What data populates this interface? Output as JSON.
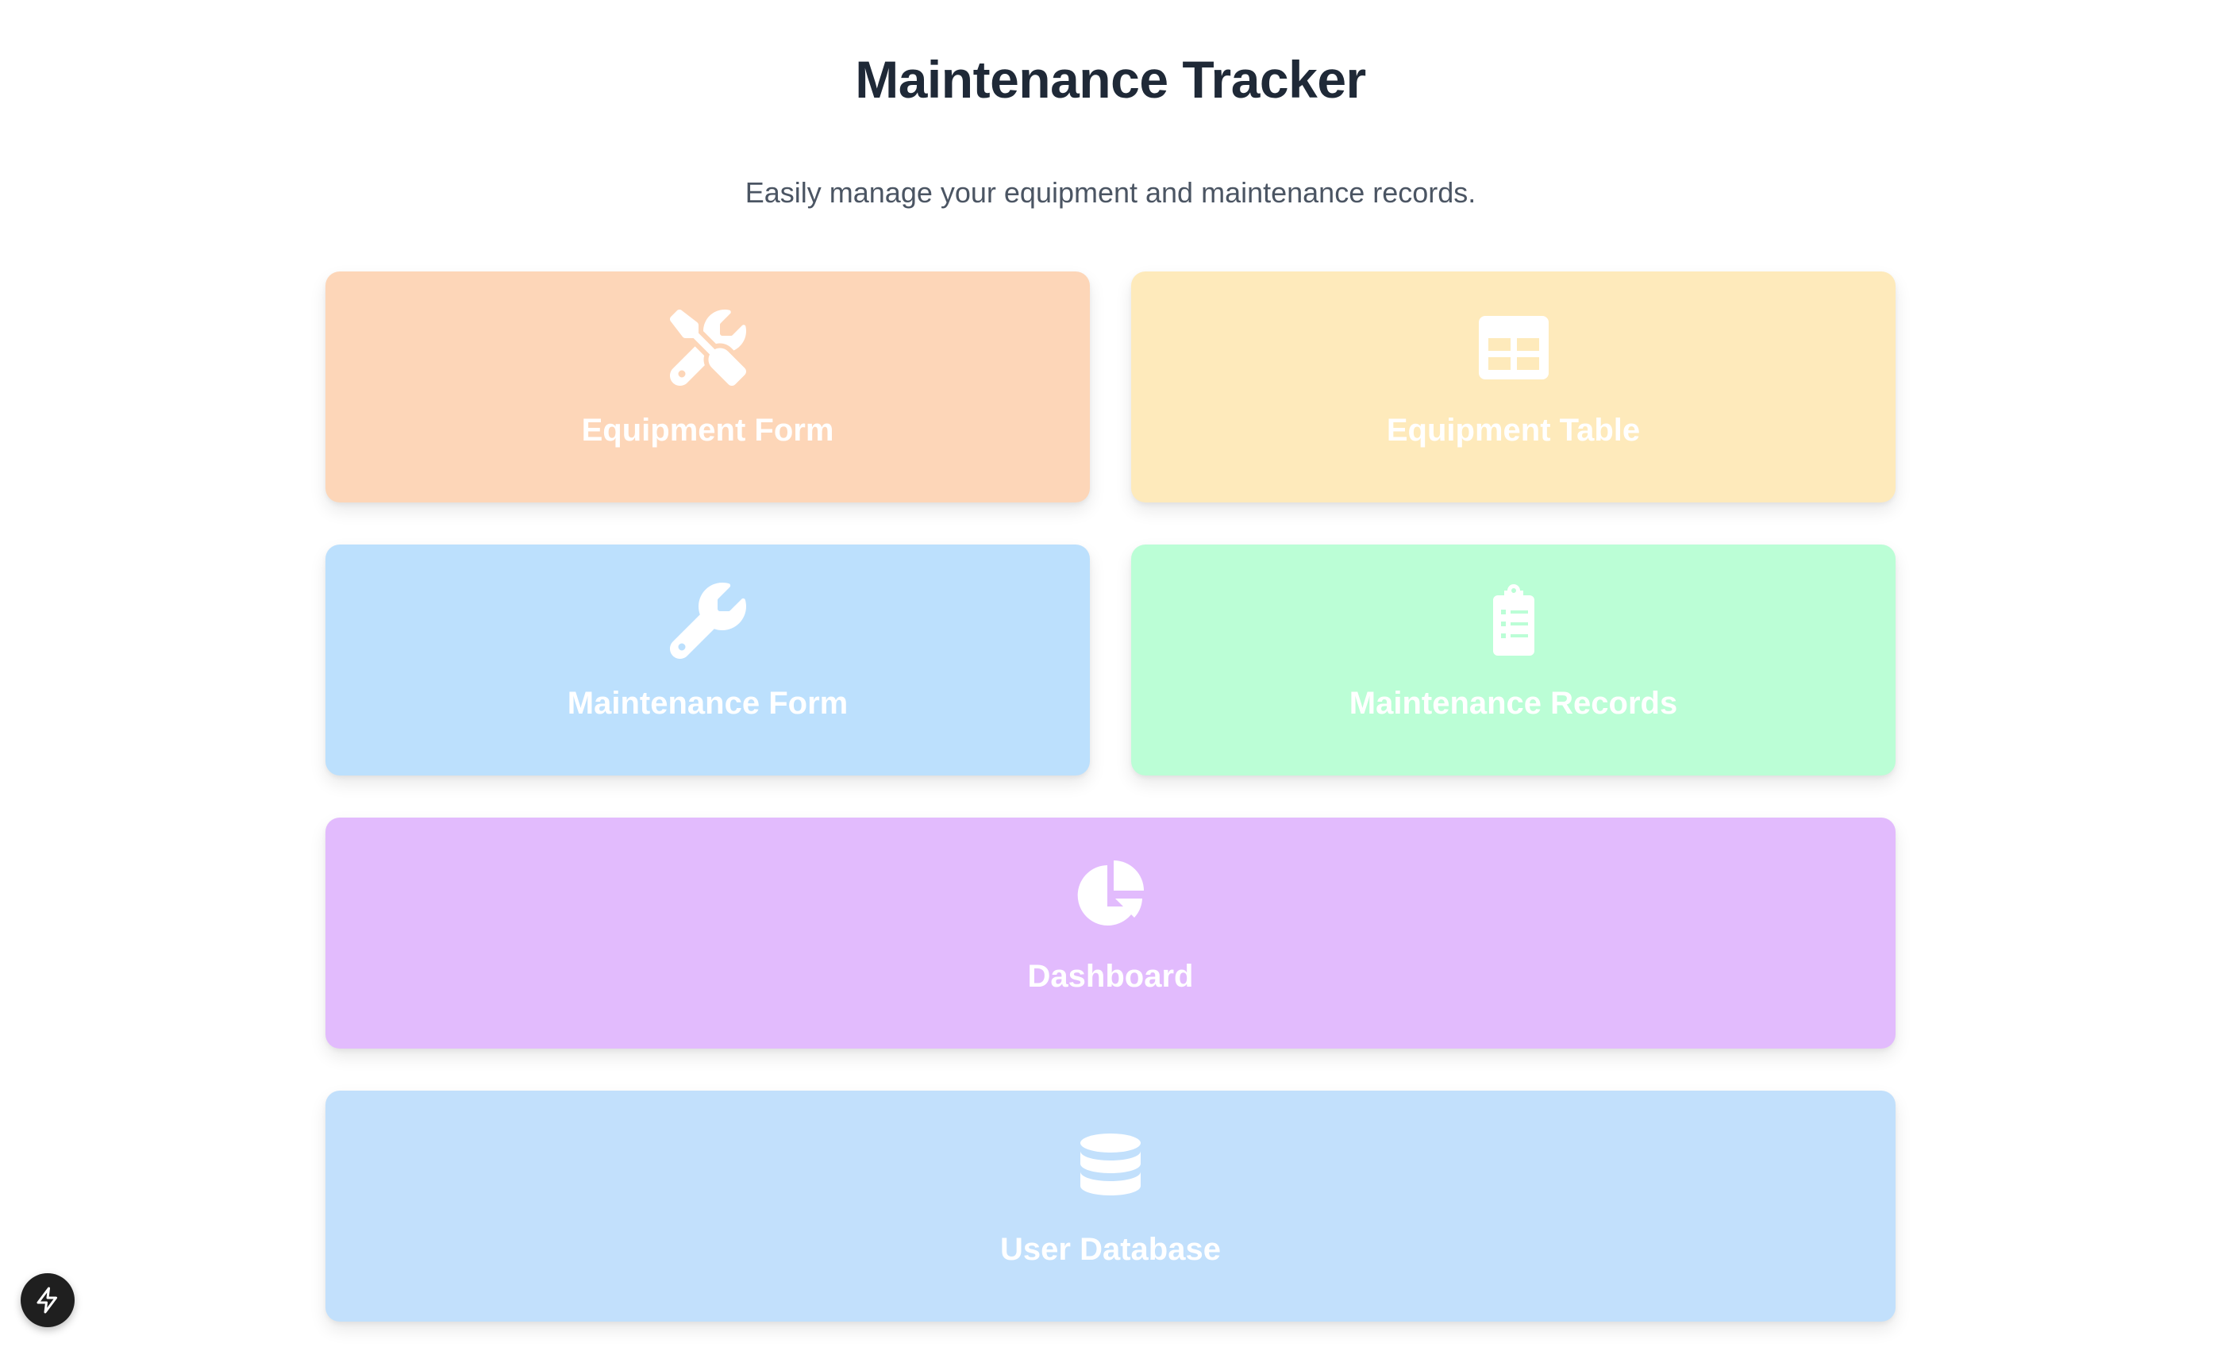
{
  "header": {
    "title": "Maintenance Tracker",
    "subtitle": "Easily manage your equipment and maintenance records."
  },
  "cards": [
    {
      "label": "Equipment Form",
      "icon": "tools-icon",
      "color": "#fdd6b8"
    },
    {
      "label": "Equipment Table",
      "icon": "table-icon",
      "color": "#feeabb"
    },
    {
      "label": "Maintenance Form",
      "icon": "wrench-icon",
      "color": "#bce0fd"
    },
    {
      "label": "Maintenance Records",
      "icon": "clipboard-list-icon",
      "color": "#bbfed6"
    },
    {
      "label": "Dashboard",
      "icon": "pie-chart-icon",
      "color": "#e2bbfd"
    },
    {
      "label": "User Database",
      "icon": "database-icon",
      "color": "#c2e0fc"
    }
  ],
  "floating_button": {
    "icon": "lightning-icon"
  }
}
